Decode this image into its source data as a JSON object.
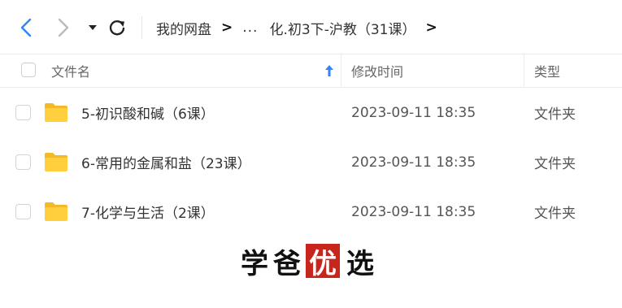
{
  "toolbar": {
    "back_icon": "chevron-left-icon",
    "forward_icon": "chevron-right-icon",
    "dropdown_icon": "caret-down-icon",
    "refresh_icon": "refresh-icon",
    "back_color": "#2f86f6",
    "forward_color": "#bbbbbb"
  },
  "breadcrumb": {
    "root": "我的网盘",
    "separator": ">",
    "ellipsis": "...",
    "current": "化.初3下-沪教（31课）"
  },
  "header": {
    "name": "文件名",
    "modified": "修改时间",
    "type": "类型",
    "sort_icon": "sort-ascending-arrow-icon",
    "sort_color": "#2f86f6"
  },
  "files": [
    {
      "name": "5-初识酸和碱（6课）",
      "modified": "2023-09-11 18:35",
      "type": "文件夹",
      "icon": "folder-icon"
    },
    {
      "name": "6-常用的金属和盐（23课）",
      "modified": "2023-09-11 18:35",
      "type": "文件夹",
      "icon": "folder-icon"
    },
    {
      "name": "7-化学与生活（2课）",
      "modified": "2023-09-11 18:35",
      "type": "文件夹",
      "icon": "folder-icon"
    }
  ],
  "watermark": {
    "char1": "学",
    "char2": "爸",
    "char3": "优",
    "char4": "选",
    "highlight_color": "#c8261c"
  }
}
